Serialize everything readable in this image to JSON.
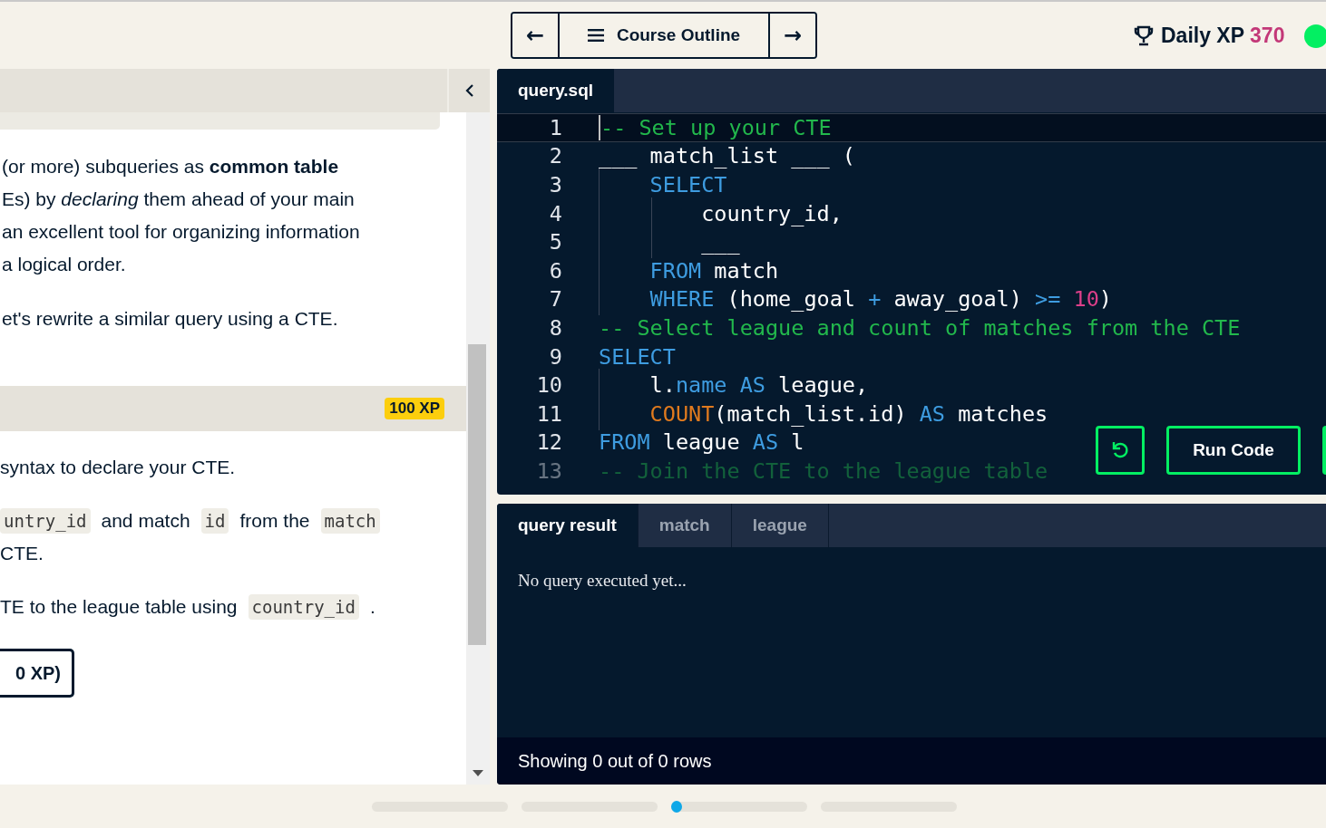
{
  "top_nav": {
    "prev_label": "←",
    "outline_label": "Course Outline",
    "next_label": "→",
    "xp_label": "Daily XP",
    "xp_value": "370"
  },
  "lesson": {
    "intro_lines": [
      "(or more) subqueries as **common table**",
      "Es) by *declaring* them ahead of your main",
      "an excellent tool for organizing information",
      " a logical order."
    ],
    "intro_tail": "et's rewrite a similar query using a CTE.",
    "exercise_xp": "100 XP",
    "instructions": [
      [
        {
          "kind": "text",
          "text": "syntax to declare your CTE."
        }
      ],
      [
        {
          "kind": "code",
          "text": "untry_id"
        },
        {
          "kind": "text",
          "text": "and match"
        },
        {
          "kind": "code",
          "text": "id"
        },
        {
          "kind": "text",
          "text": "from the"
        },
        {
          "kind": "code",
          "text": "match"
        }
      ],
      [
        {
          "kind": "text",
          "text": "CTE."
        }
      ],
      [
        {
          "kind": "text",
          "text": "TE to the league table using"
        },
        {
          "kind": "code",
          "text": "country_id"
        },
        {
          "kind": "text",
          "text": "."
        }
      ]
    ],
    "hint_button": "0 XP)"
  },
  "editor": {
    "file_tab": "query.sql",
    "lines": [
      {
        "number": "1",
        "active": true,
        "faded": false,
        "tokens": [
          {
            "kind": "comment",
            "text": "-- Set up your CTE"
          }
        ]
      },
      {
        "number": "2",
        "active": false,
        "faded": false,
        "tokens": [
          {
            "kind": "plain",
            "text": "___ match_list ___ ("
          }
        ]
      },
      {
        "number": "3",
        "active": false,
        "faded": false,
        "tokens": [
          {
            "kind": "keyword",
            "text": "    SELECT"
          }
        ]
      },
      {
        "number": "4",
        "active": false,
        "faded": false,
        "tokens": [
          {
            "kind": "plain",
            "text": "        country_id,"
          }
        ]
      },
      {
        "number": "5",
        "active": false,
        "faded": false,
        "tokens": [
          {
            "kind": "plain",
            "text": "        ___"
          }
        ]
      },
      {
        "number": "6",
        "active": false,
        "faded": false,
        "tokens": [
          {
            "kind": "keyword",
            "text": "    FROM"
          },
          {
            "kind": "plain",
            "text": " match"
          }
        ]
      },
      {
        "number": "7",
        "active": false,
        "faded": false,
        "tokens": [
          {
            "kind": "keyword",
            "text": "    WHERE"
          },
          {
            "kind": "plain",
            "text": " (home_goal "
          },
          {
            "kind": "keyword",
            "text": "+"
          },
          {
            "kind": "plain",
            "text": " away_goal) "
          },
          {
            "kind": "keyword",
            "text": ">="
          },
          {
            "kind": "number",
            "text": " 10"
          },
          {
            "kind": "plain",
            "text": ")"
          }
        ]
      },
      {
        "number": "8",
        "active": false,
        "faded": false,
        "tokens": [
          {
            "kind": "comment",
            "text": "-- Select league and count of matches from the CTE"
          }
        ]
      },
      {
        "number": "9",
        "active": false,
        "faded": false,
        "tokens": [
          {
            "kind": "keyword",
            "text": "SELECT"
          }
        ]
      },
      {
        "number": "10",
        "active": false,
        "faded": false,
        "tokens": [
          {
            "kind": "plain",
            "text": "    l."
          },
          {
            "kind": "keyword",
            "text": "name AS"
          },
          {
            "kind": "plain",
            "text": " league,"
          }
        ]
      },
      {
        "number": "11",
        "active": false,
        "faded": false,
        "tokens": [
          {
            "kind": "function",
            "text": "    COUNT"
          },
          {
            "kind": "plain",
            "text": "(match_list.id) "
          },
          {
            "kind": "keyword",
            "text": "AS"
          },
          {
            "kind": "plain",
            "text": " matches"
          }
        ]
      },
      {
        "number": "12",
        "active": false,
        "faded": false,
        "tokens": [
          {
            "kind": "keyword",
            "text": "FROM"
          },
          {
            "kind": "plain",
            "text": " league "
          },
          {
            "kind": "keyword",
            "text": "AS"
          },
          {
            "kind": "plain",
            "text": " l"
          }
        ]
      },
      {
        "number": "13",
        "active": false,
        "faded": true,
        "tokens": [
          {
            "kind": "comment",
            "text": "-- Join the CTE to the league table"
          }
        ]
      }
    ],
    "run_label": "Run Code"
  },
  "results": {
    "tabs": [
      {
        "label": "query result",
        "selected": true
      },
      {
        "label": "match",
        "selected": false
      },
      {
        "label": "league",
        "selected": false
      }
    ],
    "message": "No query executed yet...",
    "footer": "Showing 0 out of 0 rows"
  },
  "progress": [
    {
      "current": false
    },
    {
      "current": false
    },
    {
      "current": true
    },
    {
      "current": false
    }
  ]
}
